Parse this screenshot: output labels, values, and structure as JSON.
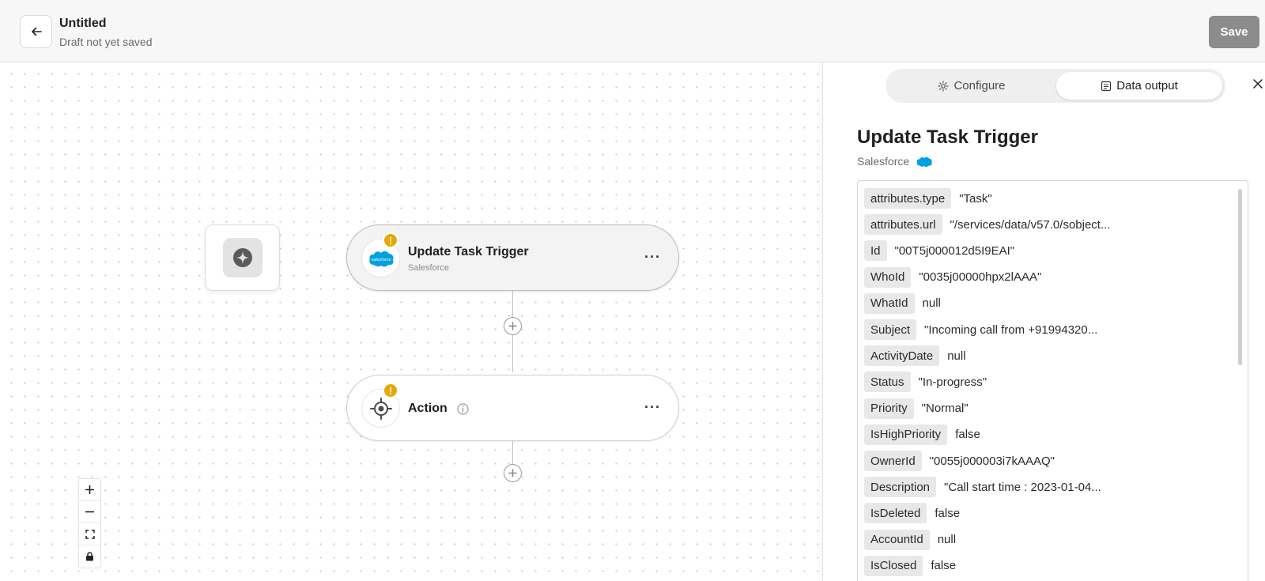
{
  "header": {
    "title": "Untitled",
    "subtitle": "Draft not yet saved",
    "save_label": "Save"
  },
  "canvas": {
    "trigger_node": {
      "title": "Update Task Trigger",
      "subtitle": "Salesforce",
      "menu": "···",
      "warning": "!"
    },
    "action_node": {
      "title": "Action",
      "menu": "···",
      "warning": "!"
    }
  },
  "panel": {
    "tabs": [
      {
        "label": "Configure",
        "icon": "gear-icon"
      },
      {
        "label": "Data output",
        "icon": "document-icon"
      }
    ],
    "active_tab": "Data output",
    "title": "Update Task Trigger",
    "subtitle": "Salesforce",
    "data_rows": [
      {
        "key": "attributes.type",
        "value": "\"Task\""
      },
      {
        "key": "attributes.url",
        "value": "\"/services/data/v57.0/sobject..."
      },
      {
        "key": "Id",
        "value": "\"00T5j000012d5I9EAI\""
      },
      {
        "key": "WhoId",
        "value": "\"0035j00000hpx2lAAA\""
      },
      {
        "key": "WhatId",
        "value": "null"
      },
      {
        "key": "Subject",
        "value": "\"Incoming call from +91994320..."
      },
      {
        "key": "ActivityDate",
        "value": "null"
      },
      {
        "key": "Status",
        "value": "\"In-progress\""
      },
      {
        "key": "Priority",
        "value": "\"Normal\""
      },
      {
        "key": "IsHighPriority",
        "value": "false"
      },
      {
        "key": "OwnerId",
        "value": "\"0055j000003i7kAAAQ\""
      },
      {
        "key": "Description",
        "value": "\"Call start time : 2023-01-04..."
      },
      {
        "key": "IsDeleted",
        "value": "false"
      },
      {
        "key": "AccountId",
        "value": "null"
      },
      {
        "key": "IsClosed",
        "value": "false"
      }
    ]
  },
  "colors": {
    "warning": "#e6a700",
    "salesforce_blue": "#00a1e0",
    "save_disabled": "#8c8c8c"
  }
}
